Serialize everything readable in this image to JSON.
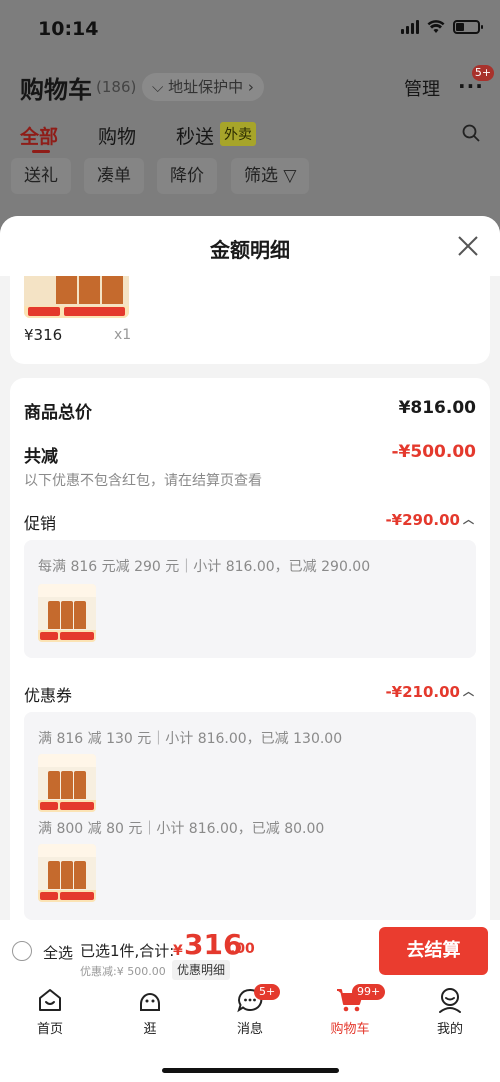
{
  "status_bar": {
    "time": "10:14"
  },
  "background_page": {
    "title": "购物车",
    "count": "(186)",
    "address_protect": "地址保护中",
    "manage": "管理",
    "more_badge": "5+",
    "tabs": [
      "全部",
      "购物",
      "秒送"
    ],
    "waimai_tag": "外卖",
    "filters": [
      "送礼",
      "凑单",
      "降价",
      "筛选"
    ]
  },
  "sheet": {
    "title": "金额明细",
    "product_price": "¥316",
    "product_qty": "x1",
    "total_price_label": "商品总价",
    "total_price_value": "¥816.00",
    "reduce_label": "共减",
    "reduce_value": "-¥500.00",
    "reduce_note": "以下优惠不包含红包，请在结算页查看",
    "promo_label": "促销",
    "promo_value": "-¥290.00",
    "promo_line": "每满 816 元减 290 元｜小计 816.00，已减 290.00",
    "coupon_label": "优惠券",
    "coupon_value": "-¥210.00",
    "coupon_line_1": "满 816 减 130 元｜小计 816.00，已减 130.00",
    "coupon_line_2": "满 800 减 80 元｜小计 816.00，已减 80.00"
  },
  "checkout": {
    "select_all": "全选",
    "selected_text": "已选1件,合计:",
    "yen": "¥",
    "total_int": "316",
    "total_dec": ".00",
    "discount": "优惠减:¥ 500.00",
    "detail_link": "优惠明细",
    "button": "去结算"
  },
  "tabbar": {
    "items": [
      {
        "label": "首页",
        "icon": "home-icon"
      },
      {
        "label": "逛",
        "icon": "face-icon"
      },
      {
        "label": "消息",
        "icon": "chat-icon",
        "badge": "5+"
      },
      {
        "label": "购物车",
        "icon": "cart-icon",
        "badge": "99+"
      },
      {
        "label": "我的",
        "icon": "profile-icon"
      }
    ]
  },
  "colors": {
    "accent": "#e4392d",
    "sheet_bg": "#f3f3f3",
    "overlay": "#7d7d7d"
  }
}
